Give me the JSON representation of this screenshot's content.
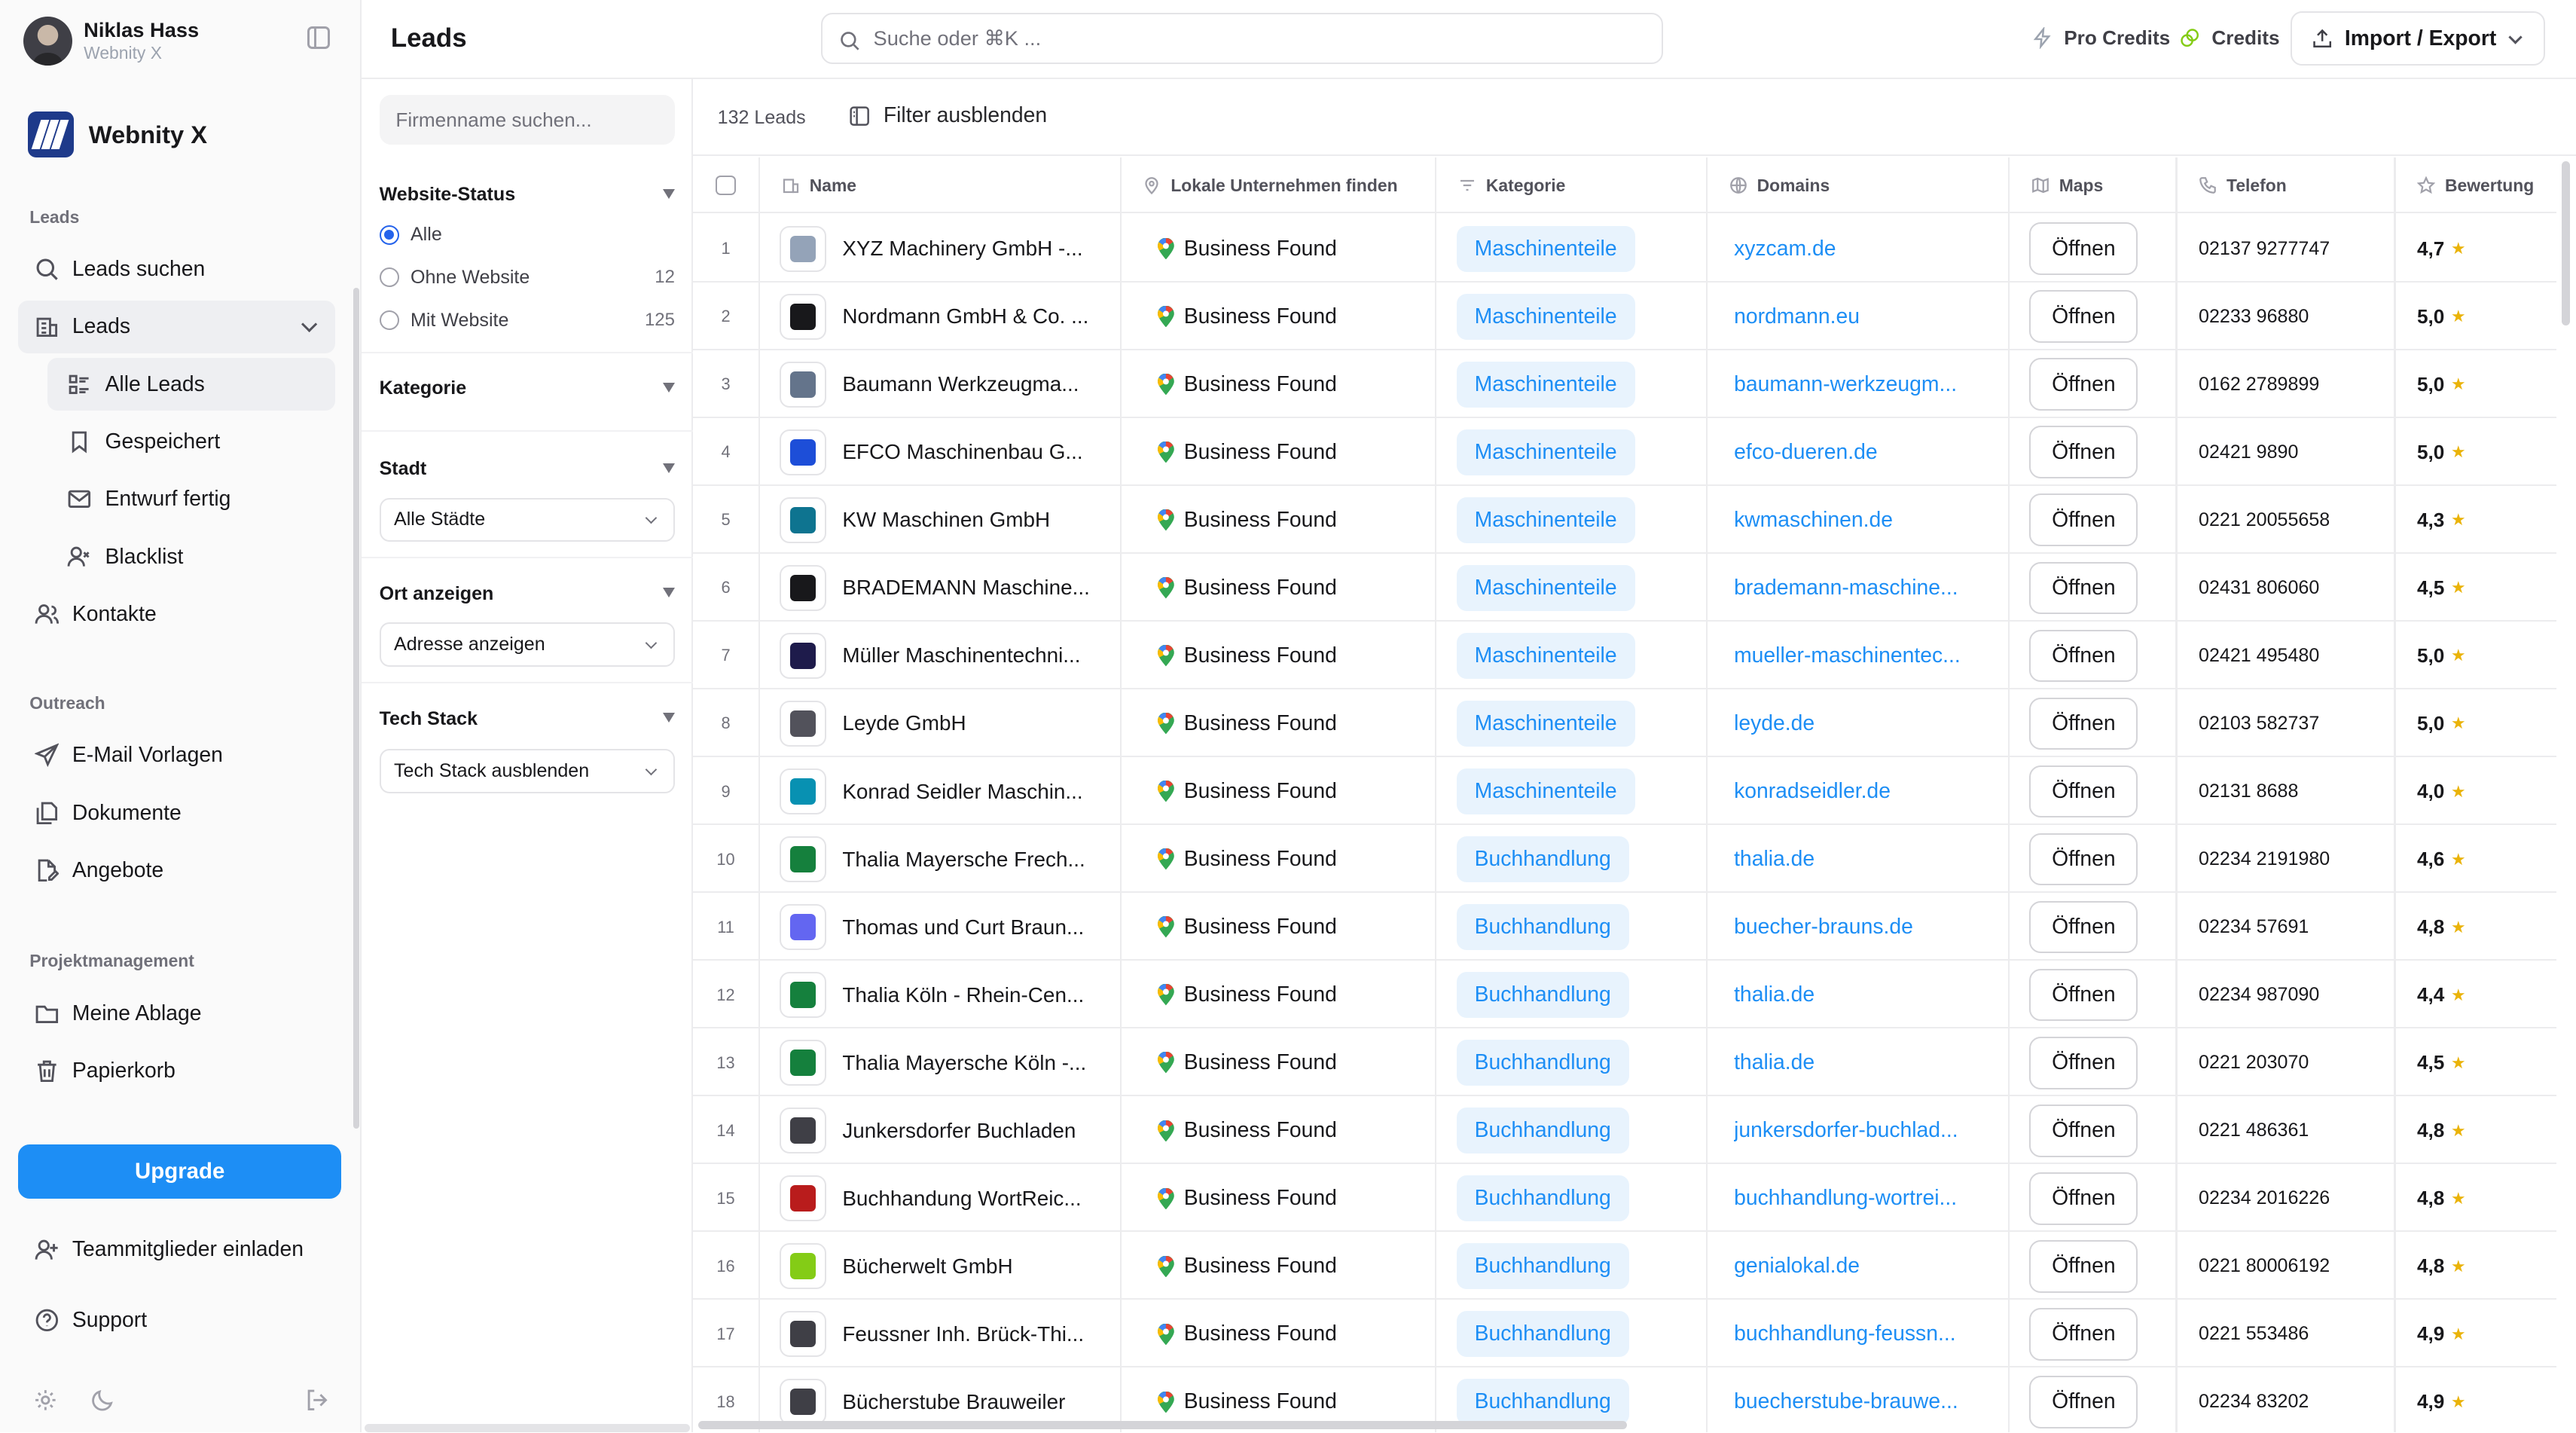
{
  "user": {
    "name": "Niklas Hass",
    "org": "Webnity X"
  },
  "brand": {
    "name": "Webnity X",
    "color": "#1e3a8a"
  },
  "sidebar": {
    "sections": {
      "leads": "Leads",
      "outreach": "Outreach",
      "project": "Projektmanagement"
    },
    "items": [
      {
        "label": "Leads suchen",
        "icon": "search-icon"
      },
      {
        "label": "Leads",
        "icon": "building-icon"
      },
      {
        "label": "Alle Leads",
        "icon": "list-icon"
      },
      {
        "label": "Gespeichert",
        "icon": "bookmark-icon"
      },
      {
        "label": "Entwurf fertig",
        "icon": "mail-icon"
      },
      {
        "label": "Blacklist",
        "icon": "user-x-icon"
      },
      {
        "label": "Kontakte",
        "icon": "users-icon"
      },
      {
        "label": "E-Mail Vorlagen",
        "icon": "send-icon"
      },
      {
        "label": "Dokumente",
        "icon": "files-icon"
      },
      {
        "label": "Angebote",
        "icon": "file-edit-icon"
      },
      {
        "label": "Meine Ablage",
        "icon": "folder-icon"
      },
      {
        "label": "Papierkorb",
        "icon": "trash-icon"
      }
    ],
    "upgrade": "Upgrade",
    "invite": "Teammitglieder einladen",
    "support": "Support"
  },
  "header": {
    "title": "Leads",
    "search_placeholder": "Suche oder ⌘K ...",
    "pro_credits": "Pro Credits",
    "credits": "Credits",
    "import_export": "Import / Export"
  },
  "filters": {
    "search_placeholder": "Firmenname suchen...",
    "website_status": "Website-Status",
    "options": [
      {
        "label": "Alle",
        "count": "",
        "selected": true
      },
      {
        "label": "Ohne Website",
        "count": "12",
        "selected": false
      },
      {
        "label": "Mit Website",
        "count": "125",
        "selected": false
      }
    ],
    "kategorie": "Kategorie",
    "stadt": "Stadt",
    "stadt_value": "Alle Städte",
    "ort": "Ort anzeigen",
    "ort_value": "Adresse anzeigen",
    "tech": "Tech Stack",
    "tech_value": "Tech Stack ausblenden"
  },
  "table": {
    "count": "132 Leads",
    "hide_filter": "Filter ausblenden",
    "columns": [
      "Name",
      "Lokale Unternehmen finden",
      "Kategorie",
      "Domains",
      "Maps",
      "Telefon",
      "Bewertung"
    ],
    "status_label": "Business Found",
    "open_label": "Öffnen",
    "rows": [
      {
        "num": "1",
        "name": "XYZ Machinery GmbH -...",
        "category": "Maschinenteile",
        "domain": "xyzcam.de",
        "phone": "02137 9277747",
        "rating": "4,7",
        "logo": "#94a3b8"
      },
      {
        "num": "2",
        "name": "Nordmann GmbH & Co. ...",
        "category": "Maschinenteile",
        "domain": "nordmann.eu",
        "phone": "02233 96880",
        "rating": "5,0",
        "logo": "#18181b"
      },
      {
        "num": "3",
        "name": "Baumann Werkzeugma...",
        "category": "Maschinenteile",
        "domain": "baumann-werkzeugm...",
        "phone": "0162 2789899",
        "rating": "5,0",
        "logo": "#64748b"
      },
      {
        "num": "4",
        "name": "EFCO Maschinenbau G...",
        "category": "Maschinenteile",
        "domain": "efco-dueren.de",
        "phone": "02421 9890",
        "rating": "5,0",
        "logo": "#1d4ed8"
      },
      {
        "num": "5",
        "name": "KW Maschinen GmbH",
        "category": "Maschinenteile",
        "domain": "kwmaschinen.de",
        "phone": "0221 20055658",
        "rating": "4,3",
        "logo": "#0e7490"
      },
      {
        "num": "6",
        "name": "BRADEMANN Maschine...",
        "category": "Maschinenteile",
        "domain": "brademann-maschine...",
        "phone": "02431 806060",
        "rating": "4,5",
        "logo": "#18181b"
      },
      {
        "num": "7",
        "name": "Müller Maschinentechni...",
        "category": "Maschinenteile",
        "domain": "mueller-maschinentec...",
        "phone": "02421 495480",
        "rating": "5,0",
        "logo": "#1e1b4b"
      },
      {
        "num": "8",
        "name": "Leyde GmbH",
        "category": "Maschinenteile",
        "domain": "leyde.de",
        "phone": "02103 582737",
        "rating": "5,0",
        "logo": "#52525b"
      },
      {
        "num": "9",
        "name": "Konrad Seidler Maschin...",
        "category": "Maschinenteile",
        "domain": "konradseidler.de",
        "phone": "02131 8688",
        "rating": "4,0",
        "logo": "#0891b2"
      },
      {
        "num": "10",
        "name": "Thalia Mayersche Frech...",
        "category": "Buchhandlung",
        "domain": "thalia.de",
        "phone": "02234 2191980",
        "rating": "4,6",
        "logo": "#15803d"
      },
      {
        "num": "11",
        "name": "Thomas und Curt Braun...",
        "category": "Buchhandlung",
        "domain": "buecher-brauns.de",
        "phone": "02234 57691",
        "rating": "4,8",
        "logo": "#6366f1"
      },
      {
        "num": "12",
        "name": "Thalia Köln - Rhein-Cen...",
        "category": "Buchhandlung",
        "domain": "thalia.de",
        "phone": "02234 987090",
        "rating": "4,4",
        "logo": "#15803d"
      },
      {
        "num": "13",
        "name": "Thalia Mayersche Köln -...",
        "category": "Buchhandlung",
        "domain": "thalia.de",
        "phone": "0221 203070",
        "rating": "4,5",
        "logo": "#15803d"
      },
      {
        "num": "14",
        "name": "Junkersdorfer Buchladen",
        "category": "Buchhandlung",
        "domain": "junkersdorfer-buchlad...",
        "phone": "0221 486361",
        "rating": "4,8",
        "logo": "#3f3f46"
      },
      {
        "num": "15",
        "name": "Buchhandung WortReic...",
        "category": "Buchhandlung",
        "domain": "buchhandlung-wortrei...",
        "phone": "02234 2016226",
        "rating": "4,8",
        "logo": "#b91c1c"
      },
      {
        "num": "16",
        "name": "Bücherwelt GmbH",
        "category": "Buchhandlung",
        "domain": "genialokal.de",
        "phone": "0221 80006192",
        "rating": "4,8",
        "logo": "#84cc16"
      },
      {
        "num": "17",
        "name": "Feussner Inh. Brück-Thi...",
        "category": "Buchhandlung",
        "domain": "buchhandlung-feussn...",
        "phone": "0221 553486",
        "rating": "4,9",
        "logo": "#3f3f46"
      },
      {
        "num": "18",
        "name": "Bücherstube Brauweiler",
        "category": "Buchhandlung",
        "domain": "buecherstube-brauwe...",
        "phone": "02234 83202",
        "rating": "4,9",
        "logo": "#3f3f46"
      }
    ]
  },
  "colors": {
    "accent": "#1d8ef5",
    "chip_bg": "#e8f3fd",
    "star": "#eab308"
  }
}
